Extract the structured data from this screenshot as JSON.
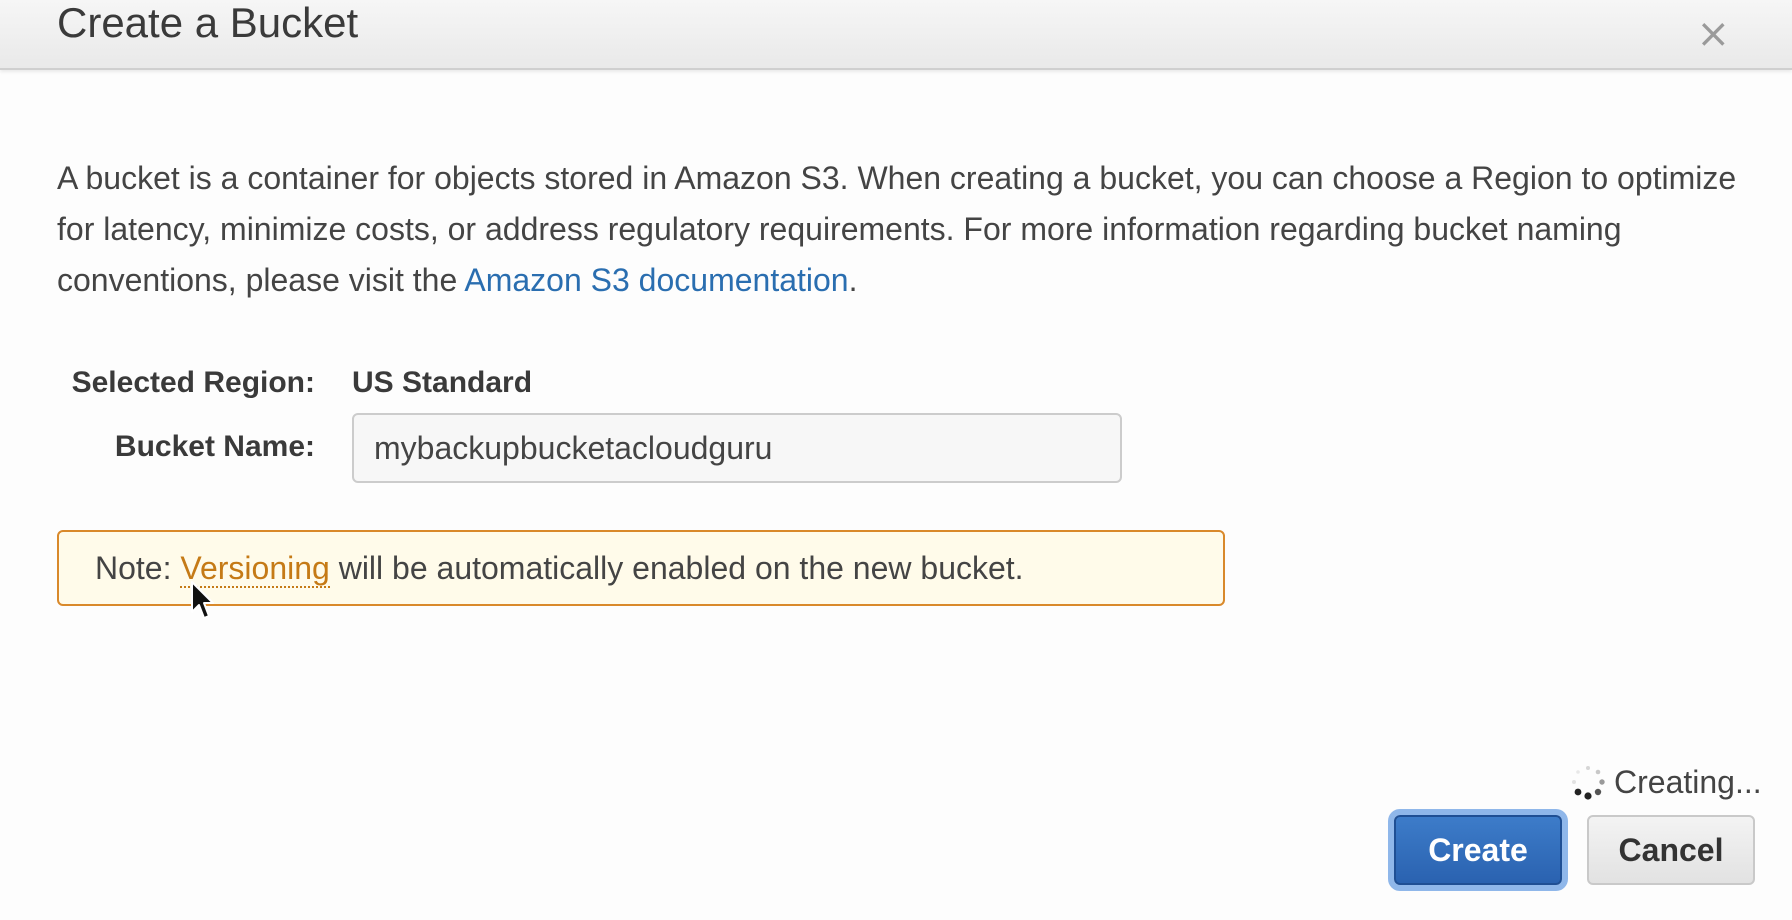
{
  "dialog": {
    "title": "Create a Bucket",
    "close_glyph": "×"
  },
  "description": {
    "text_before_link": "A bucket is a container for objects stored in Amazon S3. When creating a bucket, you can choose a Region to optimize for latency, minimize costs, or address regulatory requirements. For more information regarding bucket naming conventions, please visit the ",
    "link_text": "Amazon S3 documentation",
    "text_after_link": "."
  },
  "form": {
    "region_label": "Selected Region:",
    "region_value": "US Standard",
    "bucket_name_label": "Bucket Name:",
    "bucket_name_value": "mybackupbucketacloudguru"
  },
  "note": {
    "prefix": "Note: ",
    "link_text": "Versioning",
    "suffix": " will be automatically enabled on the new bucket."
  },
  "status": {
    "text": "Creating..."
  },
  "buttons": {
    "create_label": "Create",
    "cancel_label": "Cancel"
  },
  "colors": {
    "link": "#2a6eb0",
    "note_border": "#d9892b",
    "note_background": "#fffbea",
    "primary_button": "#2a62b0"
  },
  "icons": {
    "close": "close-icon",
    "spinner": "spinner-icon",
    "cursor": "mouse-pointer-icon"
  }
}
